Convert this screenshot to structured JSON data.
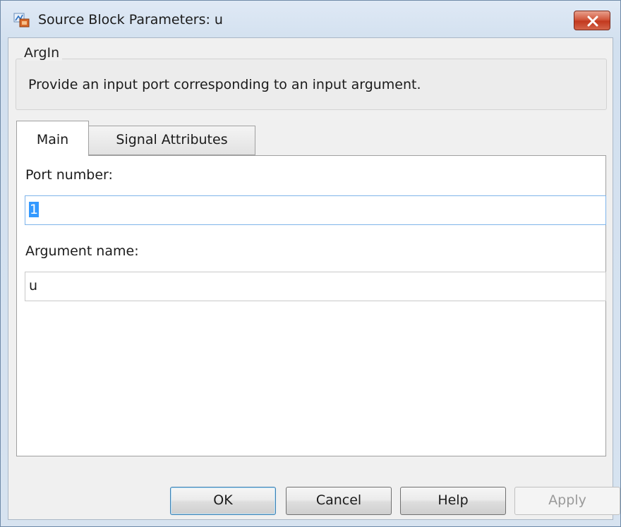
{
  "window": {
    "title": "Source Block Parameters: u",
    "icon": "simulink-block-icon",
    "close_icon": "close-icon"
  },
  "description": {
    "group_title": "ArgIn",
    "text": "Provide an input port corresponding to an input argument."
  },
  "tabs": [
    {
      "label": "Main",
      "selected": true
    },
    {
      "label": "Signal Attributes",
      "selected": false
    }
  ],
  "main": {
    "port_number_label": "Port number:",
    "port_number_value": "1",
    "argument_name_label": "Argument name:",
    "argument_name_value": "u"
  },
  "buttons": {
    "ok": "OK",
    "cancel": "Cancel",
    "help": "Help",
    "apply": "Apply"
  },
  "colors": {
    "selection": "#3399ff",
    "close_button": "#c2391f"
  }
}
